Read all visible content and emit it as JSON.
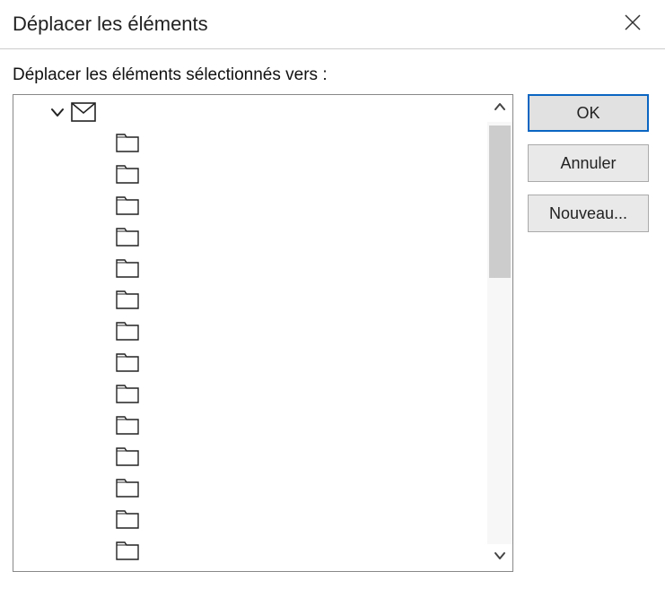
{
  "titlebar": {
    "title": "Déplacer les éléments"
  },
  "prompt": "Déplacer les éléments sélectionnés vers :",
  "tree": {
    "root_label": "",
    "folder_count": 14
  },
  "buttons": {
    "ok": "OK",
    "cancel": "Annuler",
    "new": "Nouveau..."
  }
}
